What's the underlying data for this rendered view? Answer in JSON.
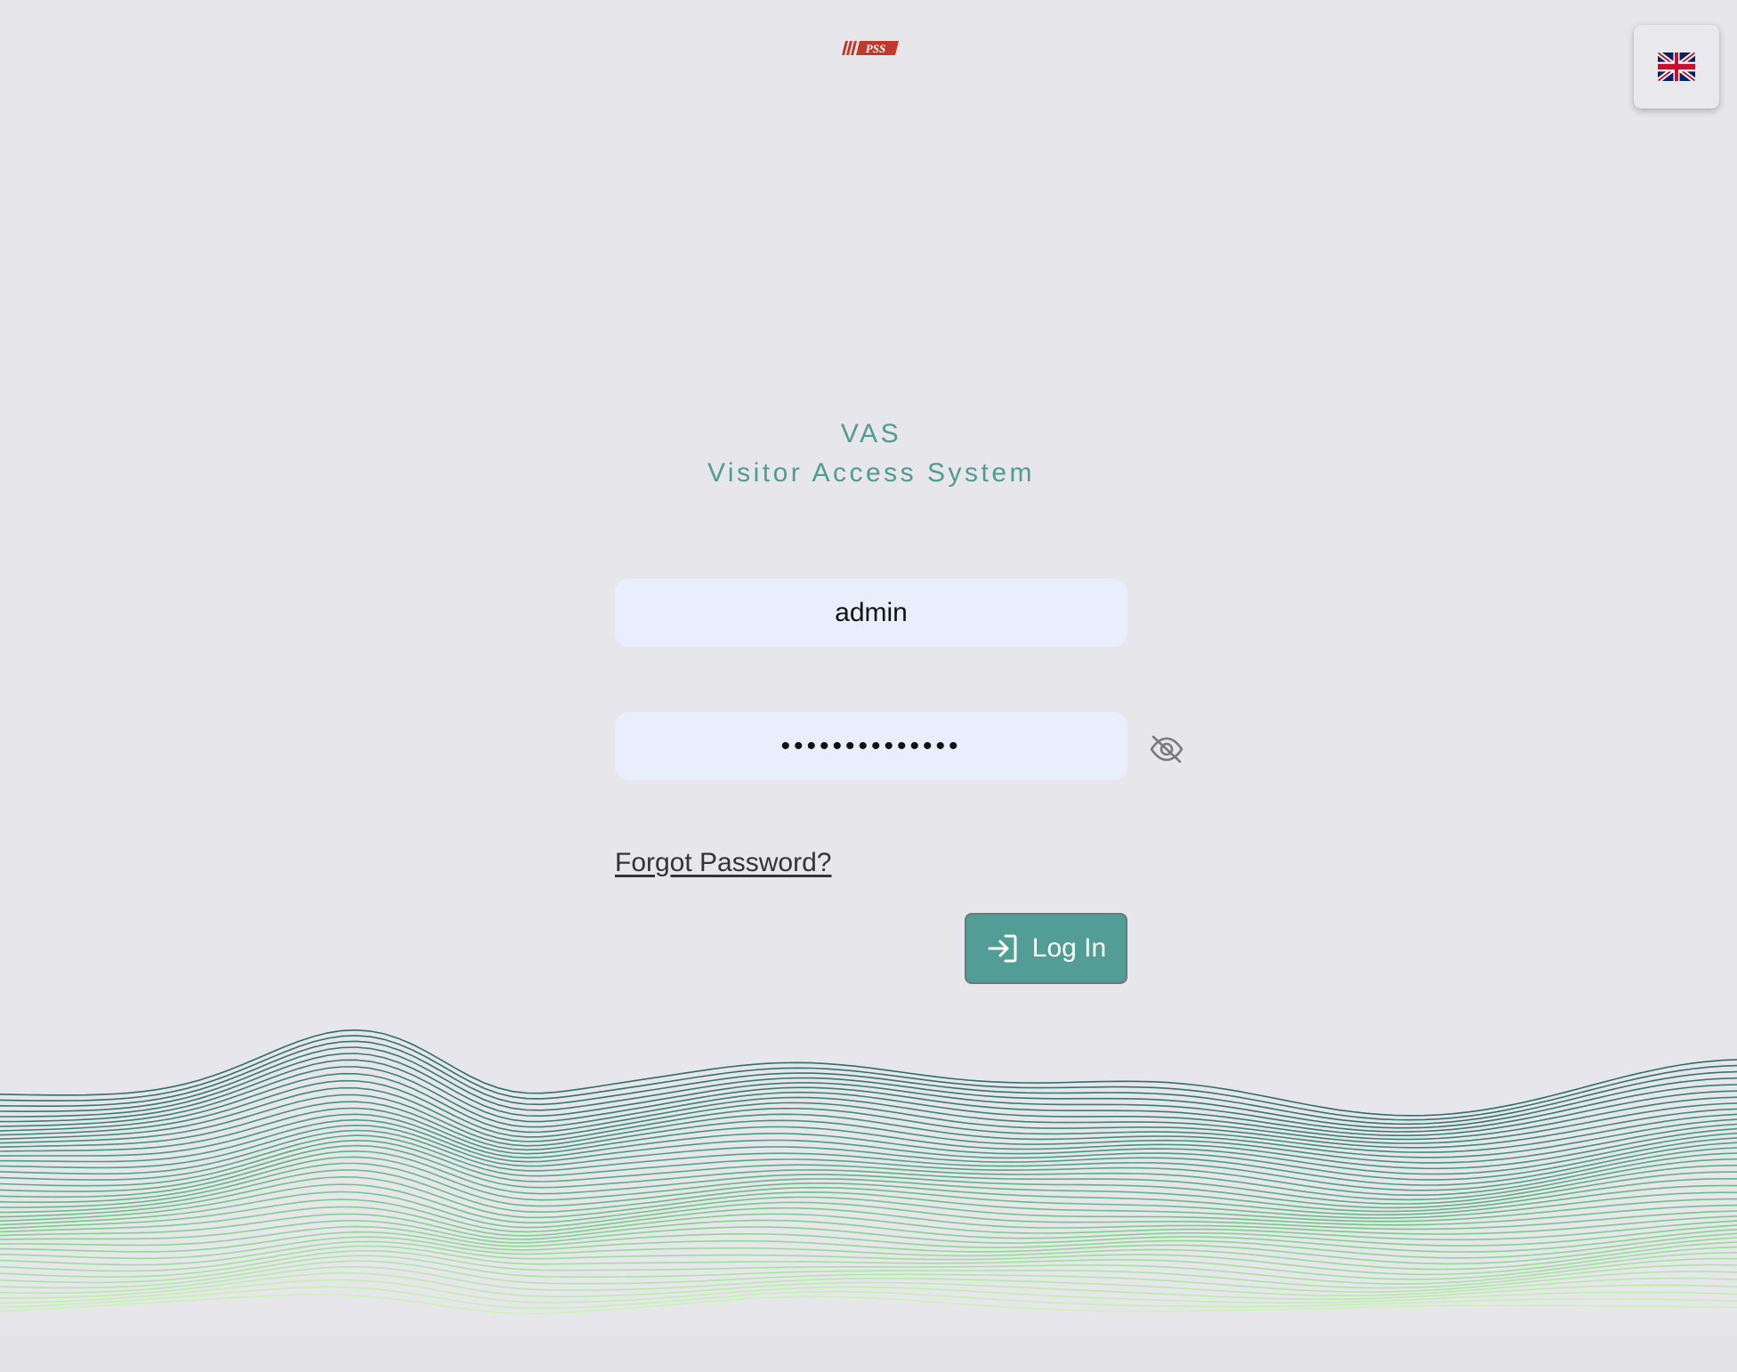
{
  "logo": {
    "text": "PSS",
    "color": "#c0392b"
  },
  "language_button": {
    "flag_icon": "uk-flag-icon"
  },
  "title": {
    "line1": "VAS",
    "line2": "Visitor Access System",
    "color": "#4f9c92"
  },
  "login_form": {
    "username_value": "admin",
    "password_value": "••••••••••••••",
    "eye_icon": "eye-off-icon",
    "forgot_password": "Forgot Password?",
    "login_label": "Log In",
    "login_icon": "log-in-icon",
    "field_bg": "#e8eefb",
    "button_color": "#529e96"
  },
  "background": {
    "wave_colors": [
      "#2f6f6a",
      "#4a9e82",
      "#7fd18c",
      "#c8f5b4"
    ]
  }
}
